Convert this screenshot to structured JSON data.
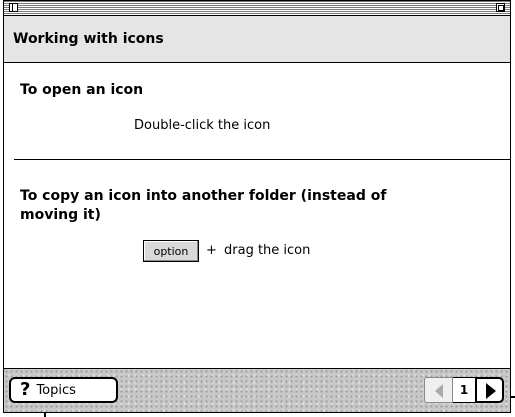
{
  "header": {
    "title": "Working with icons"
  },
  "sections": [
    {
      "heading": "To open an icon",
      "body": "Double-click the icon"
    },
    {
      "heading": "To copy an icon into another folder (instead of moving it)",
      "key_label": "option",
      "plus": "+",
      "instruction": "drag the icon"
    }
  ],
  "footer": {
    "topics_icon": "?",
    "topics_label": "Topics",
    "page_number": "1"
  },
  "icons": {
    "close": "close-box-icon",
    "zoom": "zoom-box-icon",
    "prev": "left-arrow-icon",
    "next": "right-arrow-icon"
  }
}
